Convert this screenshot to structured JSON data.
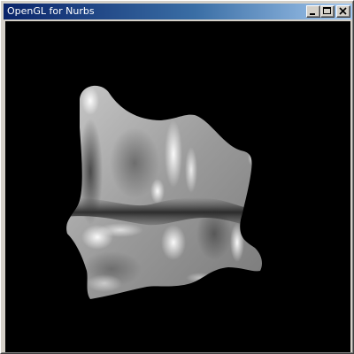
{
  "window": {
    "title": "OpenGL for Nurbs"
  },
  "title_buttons": {
    "minimize_icon": "minimize-icon",
    "maximize_icon": "maximize-icon",
    "close_icon": "close-icon"
  },
  "viewport": {
    "background": "#000000",
    "surface_color": "#a8a8a8",
    "content": "shaded-nurbs-surface"
  }
}
